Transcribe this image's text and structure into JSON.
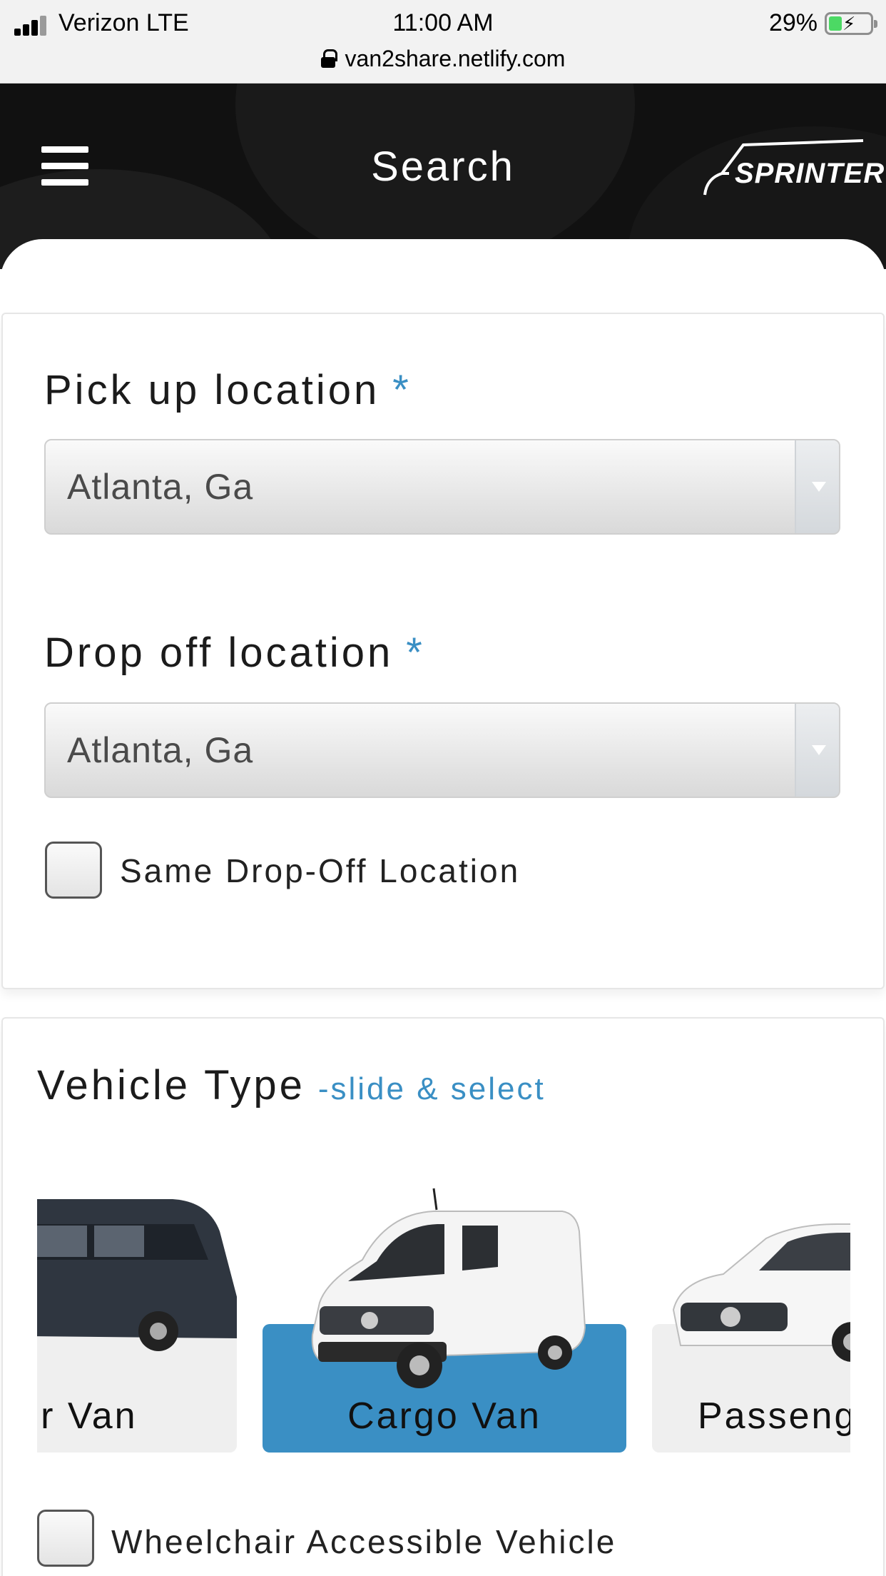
{
  "status_bar": {
    "carrier": "Verizon LTE",
    "time": "11:00 AM",
    "battery": "29%",
    "url": "van2share.netlify.com"
  },
  "header": {
    "title": "Search",
    "brand": "SPRINTER"
  },
  "form": {
    "pickup": {
      "label": "Pick up location",
      "required_mark": "*",
      "value": "Atlanta, Ga"
    },
    "dropoff": {
      "label": "Drop off location",
      "required_mark": "*",
      "value": "Atlanta, Ga"
    },
    "same_dropoff_label": "Same Drop-Off Location"
  },
  "vehicle": {
    "title": "Vehicle Type",
    "hint": "-slide & select",
    "options": [
      {
        "label": "nger Van"
      },
      {
        "label": "Cargo Van",
        "selected": true
      },
      {
        "label": "Passeng"
      }
    ],
    "wheelchair_label": "Wheelchair Accessible Vehicle"
  },
  "colors": {
    "accent": "#3a8fc4",
    "header_bg": "#111111"
  }
}
